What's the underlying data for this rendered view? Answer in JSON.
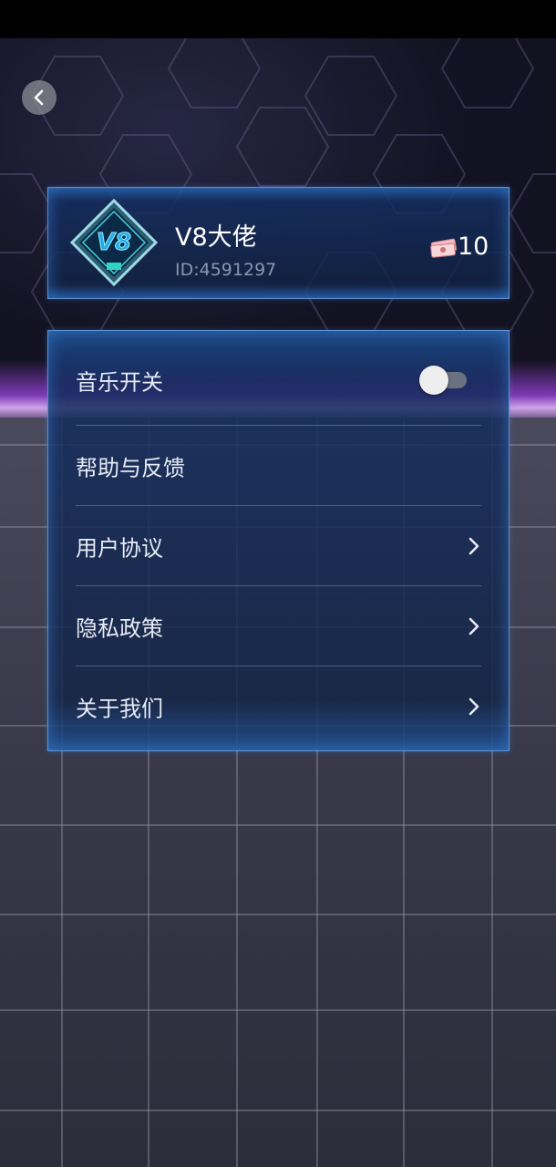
{
  "profile": {
    "username": "V8大佬",
    "user_id": "ID:4591297",
    "currency_amount": "10",
    "avatar_icon": "v8-diamond-badge-icon",
    "currency_icon": "money-bill-icon"
  },
  "settings": {
    "music_toggle": {
      "label": "音乐开关",
      "state": "off"
    },
    "items": [
      {
        "label": "帮助与反馈",
        "has_chevron": false
      },
      {
        "label": "用户协议",
        "has_chevron": true
      },
      {
        "label": "隐私政策",
        "has_chevron": true
      },
      {
        "label": "关于我们",
        "has_chevron": true
      }
    ]
  },
  "colors": {
    "accent_border": "#78aae6",
    "panel_blue": "#142d5f",
    "text_primary": "#ffffff",
    "text_secondary": "#8b97b0",
    "horizon_purple": "#a046e6"
  }
}
